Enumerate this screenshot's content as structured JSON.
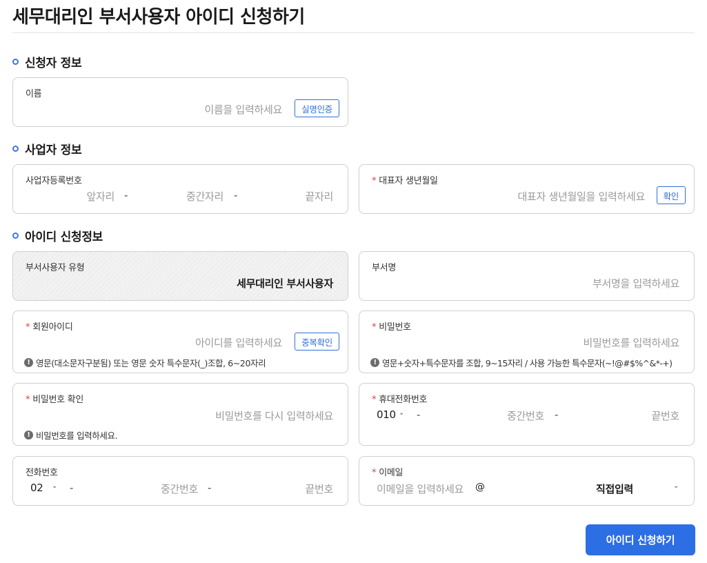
{
  "page": {
    "title": "세무대리인 부서사용자 아이디 신청하기"
  },
  "sections": {
    "applicant": "신청자 정보",
    "business": "사업자 정보",
    "id_request": "아이디 신청정보"
  },
  "applicant": {
    "name_label": "이름",
    "name_placeholder": "이름을 입력하세요",
    "verify_button": "실명인증"
  },
  "business": {
    "reg_no_label": "사업자등록번호",
    "reg_no_front": "앞자리",
    "reg_no_middle": "중간자리",
    "reg_no_last": "끝자리",
    "dash": "-",
    "rep_birth_label": "대표자 생년월일",
    "rep_birth_placeholder": "대표자 생년월일을 입력하세요",
    "confirm_button": "확인"
  },
  "id_request": {
    "user_type_label": "부서사용자 유형",
    "user_type_value": "세무대리인 부서사용자",
    "dept_label": "부서명",
    "dept_placeholder": "부서명을 입력하세요",
    "member_id_label": "회원아이디",
    "member_id_placeholder": "아이디를 입력하세요",
    "dup_check_button": "중복확인",
    "member_id_hint": "영문(대소문자구분됨) 또는 영문 숫자 특수문자(_)조합, 6~20자리",
    "password_label": "비밀번호",
    "password_placeholder": "비밀번호를 입력하세요",
    "password_hint": "영문+숫자+특수문자를 조합, 9~15자리 / 사용 가능한 특수문자(~!@#$%^&*-+)",
    "password_confirm_label": "비밀번호 확인",
    "password_confirm_placeholder": "비밀번호를 다시 입력하세요",
    "password_confirm_hint": "비밀번호를 입력하세요.",
    "mobile_label": "휴대전화번호",
    "mobile_prefix": "010",
    "mobile_middle": "중간번호",
    "mobile_last": "끝번호",
    "phone_label": "전화번호",
    "phone_prefix": "02",
    "phone_middle": "중간번호",
    "phone_last": "끝번호",
    "email_label": "이메일",
    "email_placeholder": "이메일을 입력하세요",
    "email_at": "@",
    "email_domain": "직접입력",
    "required_mark": "*",
    "info_mark": "!",
    "chevron": "⌄"
  },
  "submit_button": "아이디 신청하기",
  "colors": {
    "accent": "#2c6fe5",
    "required": "#e23b3b",
    "border": "#cfcfcf"
  }
}
